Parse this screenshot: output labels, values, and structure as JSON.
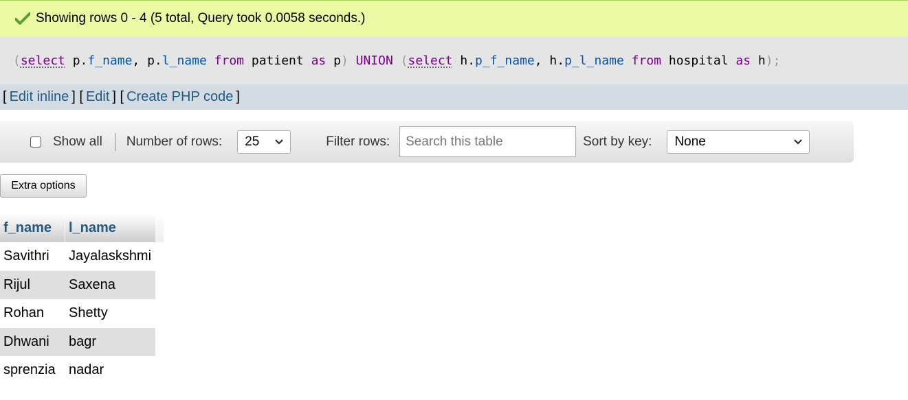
{
  "message": {
    "text": "Showing rows 0 - 4 (5 total, Query took 0.0058 seconds.)",
    "icon": "check-icon",
    "success_color": "#56a033"
  },
  "sql": {
    "p_open1": "(",
    "kw_select1": "select",
    "expr1": " p.",
    "field1": "f_name",
    "sep1": ", p.",
    "field2": "l_name",
    "sp1": " ",
    "kw_from1": "from",
    "table1": " patient ",
    "kw_as1": "as",
    "alias1": " p",
    "p_close1": ")",
    "sp2": " ",
    "kw_union": "UNION",
    "sp3": " ",
    "p_open2": "(",
    "kw_select2": "select",
    "expr2": " h.",
    "field3": "p_f_name",
    "sep2": ", h.",
    "field4": "p_l_name",
    "sp4": " ",
    "kw_from2": "from",
    "table2": " hospital ",
    "kw_as2": "as",
    "alias2": " h",
    "p_close2": ");"
  },
  "actions": {
    "open1": "[",
    "edit_inline": "Edit inline",
    "sep1": "] [",
    "edit": "Edit",
    "sep2": "] [",
    "create_php": "Create PHP code",
    "close": "]"
  },
  "navigation": {
    "show_all_label": "Show all",
    "rows_label": "Number of rows:",
    "rows_value": "25",
    "filter_label": "Filter rows:",
    "filter_placeholder": "Search this table",
    "sort_label": "Sort by key:",
    "sort_value": "None"
  },
  "extra_options_label": "Extra options",
  "table": {
    "columns": [
      "f_name",
      "l_name"
    ],
    "rows": [
      [
        "Savithri",
        "Jayalaskshmi"
      ],
      [
        "Rijul",
        "Saxena"
      ],
      [
        "Rohan",
        "Shetty"
      ],
      [
        "Dhwani",
        "bagr"
      ],
      [
        "sprenzia",
        "nadar"
      ]
    ]
  }
}
